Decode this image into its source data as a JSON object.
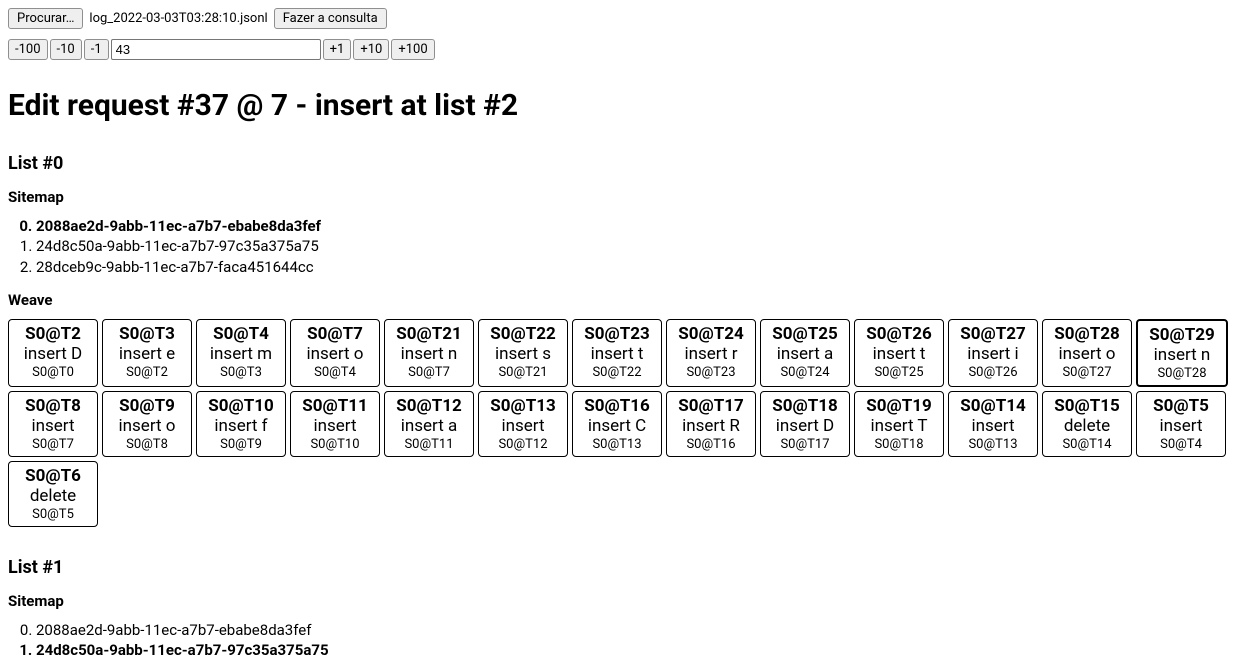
{
  "top": {
    "browse_label": "Procurar…",
    "filename": "log_2022-03-03T03:28:10.jsonl",
    "query_label": "Fazer a consulta"
  },
  "nav": {
    "minus100": "-100",
    "minus10": "-10",
    "minus1": "-1",
    "value": "43",
    "plus1": "+1",
    "plus10": "+10",
    "plus100": "+100"
  },
  "heading": "Edit request #37 @ 7 - insert at list #2",
  "lists": [
    {
      "title": "List #0",
      "sitemap_label": "Sitemap",
      "sitemap_start": 0,
      "sitemap": [
        {
          "text": "2088ae2d-9abb-11ec-a7b7-ebabe8da3fef",
          "bold": true
        },
        {
          "text": "24d8c50a-9abb-11ec-a7b7-97c35a375a75",
          "bold": false
        },
        {
          "text": "28dceb9c-9abb-11ec-a7b7-faca451644cc",
          "bold": false
        }
      ],
      "weave_label": "Weave",
      "weave": [
        {
          "title": "S0@T2",
          "action": "insert D",
          "ref": "S0@T0",
          "highlighted": false
        },
        {
          "title": "S0@T3",
          "action": "insert e",
          "ref": "S0@T2",
          "highlighted": false
        },
        {
          "title": "S0@T4",
          "action": "insert m",
          "ref": "S0@T3",
          "highlighted": false
        },
        {
          "title": "S0@T7",
          "action": "insert o",
          "ref": "S0@T4",
          "highlighted": false
        },
        {
          "title": "S0@T21",
          "action": "insert n",
          "ref": "S0@T7",
          "highlighted": false
        },
        {
          "title": "S0@T22",
          "action": "insert s",
          "ref": "S0@T21",
          "highlighted": false
        },
        {
          "title": "S0@T23",
          "action": "insert t",
          "ref": "S0@T22",
          "highlighted": false
        },
        {
          "title": "S0@T24",
          "action": "insert r",
          "ref": "S0@T23",
          "highlighted": false
        },
        {
          "title": "S0@T25",
          "action": "insert a",
          "ref": "S0@T24",
          "highlighted": false
        },
        {
          "title": "S0@T26",
          "action": "insert t",
          "ref": "S0@T25",
          "highlighted": false
        },
        {
          "title": "S0@T27",
          "action": "insert i",
          "ref": "S0@T26",
          "highlighted": false
        },
        {
          "title": "S0@T28",
          "action": "insert o",
          "ref": "S0@T27",
          "highlighted": false
        },
        {
          "title": "S0@T29",
          "action": "insert n",
          "ref": "S0@T28",
          "highlighted": true
        },
        {
          "title": "S0@T8",
          "action": "insert",
          "ref": "S0@T7",
          "highlighted": false
        },
        {
          "title": "S0@T9",
          "action": "insert o",
          "ref": "S0@T8",
          "highlighted": false
        },
        {
          "title": "S0@T10",
          "action": "insert f",
          "ref": "S0@T9",
          "highlighted": false
        },
        {
          "title": "S0@T11",
          "action": "insert",
          "ref": "S0@T10",
          "highlighted": false
        },
        {
          "title": "S0@T12",
          "action": "insert a",
          "ref": "S0@T11",
          "highlighted": false
        },
        {
          "title": "S0@T13",
          "action": "insert",
          "ref": "S0@T12",
          "highlighted": false
        },
        {
          "title": "S0@T16",
          "action": "insert C",
          "ref": "S0@T13",
          "highlighted": false
        },
        {
          "title": "S0@T17",
          "action": "insert R",
          "ref": "S0@T16",
          "highlighted": false
        },
        {
          "title": "S0@T18",
          "action": "insert D",
          "ref": "S0@T17",
          "highlighted": false
        },
        {
          "title": "S0@T19",
          "action": "insert T",
          "ref": "S0@T18",
          "highlighted": false
        },
        {
          "title": "S0@T14",
          "action": "insert",
          "ref": "S0@T13",
          "highlighted": false
        },
        {
          "title": "S0@T15",
          "action": "delete",
          "ref": "S0@T14",
          "highlighted": false
        },
        {
          "title": "S0@T5",
          "action": "insert",
          "ref": "S0@T4",
          "highlighted": false
        },
        {
          "title": "S0@T6",
          "action": "delete",
          "ref": "S0@T5",
          "highlighted": false
        }
      ]
    },
    {
      "title": "List #1",
      "sitemap_label": "Sitemap",
      "sitemap_start": 0,
      "sitemap": [
        {
          "text": "2088ae2d-9abb-11ec-a7b7-ebabe8da3fef",
          "bold": false
        },
        {
          "text": "24d8c50a-9abb-11ec-a7b7-97c35a375a75",
          "bold": true
        }
      ],
      "weave_label": null,
      "weave": []
    }
  ]
}
